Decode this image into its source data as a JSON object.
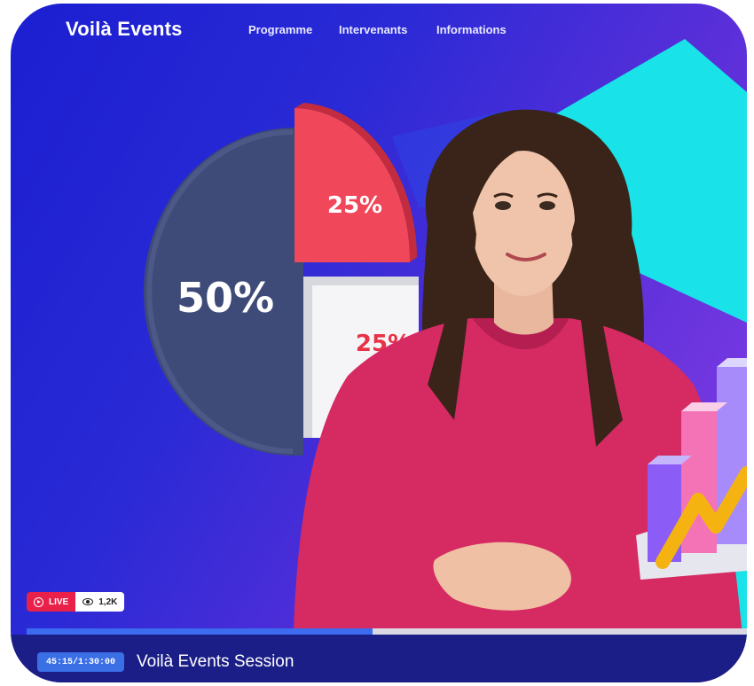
{
  "brand": {
    "name": "Voilà Events"
  },
  "nav": {
    "items": [
      "Programme",
      "Intervenants",
      "Informations"
    ]
  },
  "pie": {
    "labels": [
      "50%",
      "25%",
      "25%"
    ]
  },
  "status": {
    "live_label": "LIVE",
    "viewers": "1,2K"
  },
  "player": {
    "progress_fraction": 0.48,
    "time_display": "45:15/1:30:00",
    "session_title": "Voilà Events Session"
  },
  "colors": {
    "background": "#2a2ad6",
    "accent_teal": "#19e3e8",
    "live_red": "#e8204a",
    "progress_blue": "#3b6cf0",
    "sweater_pink": "#d62a62"
  },
  "icons": [
    "live-icon",
    "eye-icon"
  ]
}
